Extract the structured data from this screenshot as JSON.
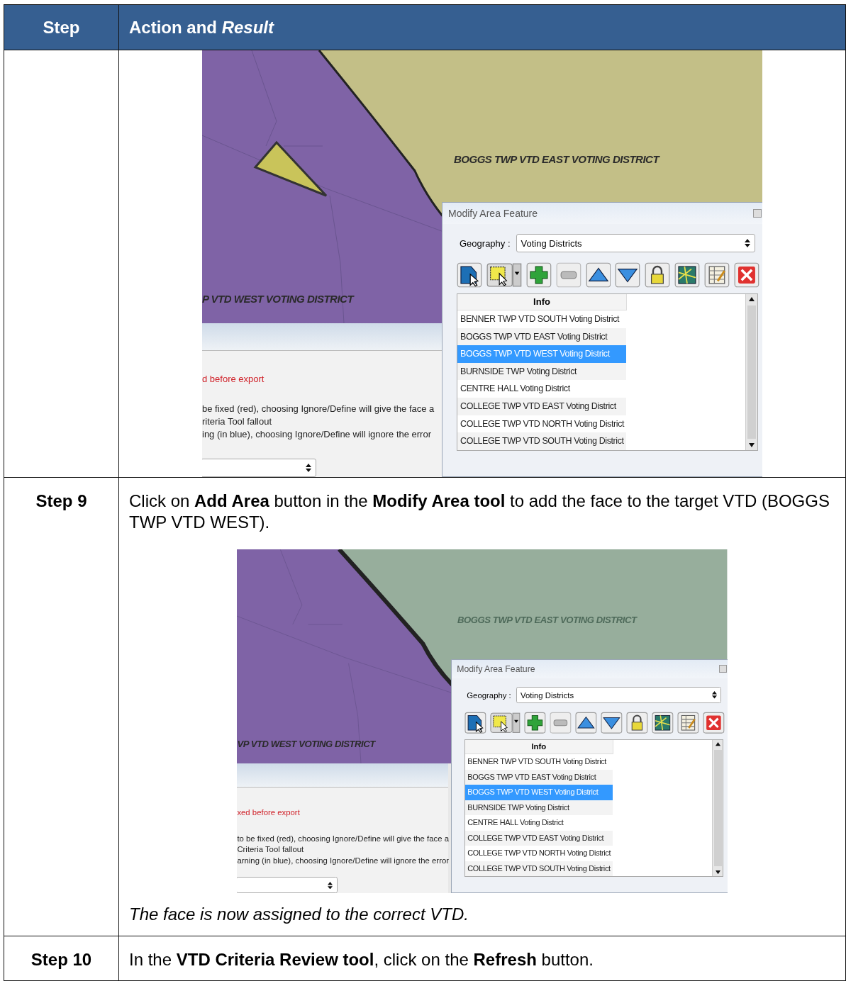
{
  "table": {
    "columns": [
      "Step",
      "Action and *Result*"
    ],
    "rows": [
      {
        "step": "",
        "blocks": [
          {
            "kind": "screenshot",
            "face_reassigned": false,
            "east_label": "BOGGS TWP VTD EAST VOTING DISTRICT",
            "west_label": "P VTD WEST VOTING DISTRICT",
            "panel_lines": [
              {
                "kind": "error",
                "text": "d before export"
              },
              {
                "kind": "plain",
                "text": "be fixed (red), choosing Ignore/Define will give the face a"
              },
              {
                "kind": "plain",
                "text": "riteria Tool fallout"
              },
              {
                "kind": "plain",
                "text": "ing (in blue), choosing Ignore/Define will ignore the error"
              }
            ],
            "dialog": {
              "title": "Modify Area Feature",
              "geography_label": "Geography :",
              "geography_value": "Voting Districts",
              "list_header": "Info",
              "items": [
                {
                  "label": "BENNER TWP VTD SOUTH Voting District",
                  "selected": false
                },
                {
                  "label": "BOGGS TWP VTD EAST Voting District",
                  "selected": false
                },
                {
                  "label": "BOGGS TWP VTD WEST Voting District",
                  "selected": true
                },
                {
                  "label": "BURNSIDE TWP Voting District",
                  "selected": false
                },
                {
                  "label": "CENTRE HALL Voting District",
                  "selected": false
                },
                {
                  "label": "COLLEGE TWP VTD EAST Voting District",
                  "selected": false
                },
                {
                  "label": "COLLEGE TWP VTD NORTH Voting District",
                  "selected": false
                },
                {
                  "label": "COLLEGE TWP VTD SOUTH Voting District",
                  "selected": false
                }
              ]
            }
          }
        ]
      },
      {
        "step": "Step 9",
        "blocks": [
          {
            "kind": "text",
            "text": "Click on **Add Area** button in the **Modify Area tool** to add the face to the target VTD (BOGGS TWP VTD WEST)."
          },
          {
            "kind": "screenshot",
            "face_reassigned": true,
            "east_label": "BOGGS TWP VTD EAST VOTING DISTRICT",
            "west_label": "VP VTD WEST VOTING DISTRICT",
            "panel_lines": [
              {
                "kind": "error",
                "text": "xed before export"
              },
              {
                "kind": "plain",
                "text": "to be fixed (red), choosing Ignore/Define will give the face a"
              },
              {
                "kind": "plain",
                "text": "Criteria Tool fallout"
              },
              {
                "kind": "plain",
                "text": "arning (in blue), choosing Ignore/Define will ignore the error"
              }
            ],
            "dialog": {
              "title": "Modify Area Feature",
              "geography_label": "Geography :",
              "geography_value": "Voting Districts",
              "list_header": "Info",
              "items": [
                {
                  "label": "BENNER TWP VTD SOUTH Voting District",
                  "selected": false
                },
                {
                  "label": "BOGGS TWP VTD EAST Voting District",
                  "selected": false
                },
                {
                  "label": "BOGGS TWP VTD WEST Voting District",
                  "selected": true
                },
                {
                  "label": "BURNSIDE TWP Voting District",
                  "selected": false
                },
                {
                  "label": "CENTRE HALL Voting District",
                  "selected": false
                },
                {
                  "label": "COLLEGE TWP VTD EAST Voting District",
                  "selected": false
                },
                {
                  "label": "COLLEGE TWP VTD NORTH Voting District",
                  "selected": false
                },
                {
                  "label": "COLLEGE TWP VTD SOUTH Voting District",
                  "selected": false
                }
              ]
            }
          },
          {
            "kind": "note",
            "text": "The face is now assigned to the correct VTD."
          }
        ]
      },
      {
        "step": "Step 10",
        "blocks": [
          {
            "kind": "text",
            "text": "In the **VTD Criteria Review tool**, click on the **Refresh** button."
          }
        ]
      }
    ]
  }
}
